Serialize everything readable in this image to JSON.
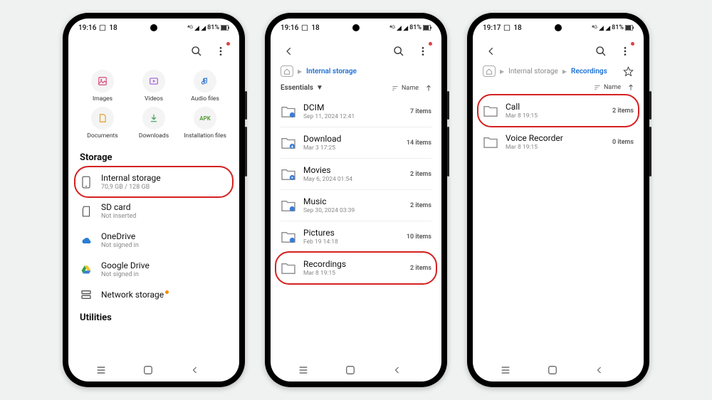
{
  "status": {
    "time_s1": "19:16",
    "time_s2": "19:16",
    "time_s3": "19:17",
    "notif_count": "18",
    "battery": "81%"
  },
  "screen1": {
    "categories": [
      {
        "label": "Images",
        "icon_color": "#d84a7a"
      },
      {
        "label": "Videos",
        "icon_color": "#a05ad6"
      },
      {
        "label": "Audio files",
        "icon_color": "#3a7cd6"
      },
      {
        "label": "Documents",
        "icon_color": "#e0a030"
      },
      {
        "label": "Downloads",
        "icon_color": "#3aa05a"
      },
      {
        "label": "Installation files",
        "icon_color": "#5aa040"
      }
    ],
    "storage_heading": "Storage",
    "storage_items": [
      {
        "title": "Internal storage",
        "sub": "70,9 GB / 128 GB",
        "highlighted": true
      },
      {
        "title": "SD card",
        "sub": "Not inserted"
      },
      {
        "title": "OneDrive",
        "sub": "Not signed in"
      },
      {
        "title": "Google Drive",
        "sub": "Not signed in"
      },
      {
        "title": "Network storage",
        "sub": "",
        "orange_dot": true
      }
    ],
    "utilities_heading": "Utilities"
  },
  "screen2": {
    "breadcrumb_label": "Internal storage",
    "essentials_label": "Essentials",
    "sort_label": "Name",
    "folders": [
      {
        "title": "DCIM",
        "sub": "Sep 11, 2024 12:41",
        "count": "7 items",
        "badge": "gallery"
      },
      {
        "title": "Download",
        "sub": "Mar 3 17:25",
        "count": "14 items",
        "badge": "down"
      },
      {
        "title": "Movies",
        "sub": "May 6, 2024 01:54",
        "count": "2 items",
        "badge": "play"
      },
      {
        "title": "Music",
        "sub": "Sep 30, 2024 03:39",
        "count": "2 items",
        "badge": "note"
      },
      {
        "title": "Pictures",
        "sub": "Feb 19 14:18",
        "count": "10 items",
        "badge": "pic"
      },
      {
        "title": "Recordings",
        "sub": "Mar 8 19:15",
        "count": "2 items",
        "highlighted": true
      }
    ]
  },
  "screen3": {
    "breadcrumb_1": "Internal storage",
    "breadcrumb_2": "Recordings",
    "sort_label": "Name",
    "folders": [
      {
        "title": "Call",
        "sub": "Mar 8 19:15",
        "count": "2 items",
        "highlighted": true
      },
      {
        "title": "Voice Recorder",
        "sub": "Mar 8 19:15",
        "count": "0 items"
      }
    ]
  }
}
